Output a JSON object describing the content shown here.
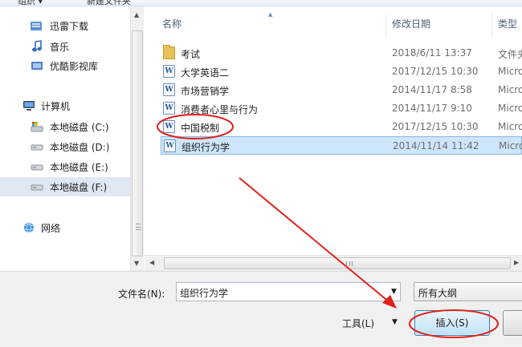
{
  "toolbar": {
    "organize": "组织 ▾",
    "new_folder": "新建文件夹"
  },
  "nav": {
    "items": [
      {
        "label": "迅雷下载",
        "icon": "thunder-download-folder-icon"
      },
      {
        "label": "音乐",
        "icon": "music-icon"
      },
      {
        "label": "优酷影视库",
        "icon": "video-library-icon"
      },
      {
        "label": "计算机",
        "icon": "computer-icon"
      },
      {
        "label": "本地磁盘 (C:)",
        "icon": "system-drive-icon"
      },
      {
        "label": "本地磁盘 (D:)",
        "icon": "drive-icon"
      },
      {
        "label": "本地磁盘 (E:)",
        "icon": "drive-icon"
      },
      {
        "label": "本地磁盘 (F:)",
        "icon": "drive-icon"
      },
      {
        "label": "网络",
        "icon": "network-icon"
      }
    ]
  },
  "list": {
    "columns": {
      "name": "名称",
      "date": "修改日期",
      "type": "类型"
    },
    "rows": [
      {
        "name": "考试",
        "date": "2018/6/11 13:37",
        "type": "文件夹",
        "icon": "folder-icon"
      },
      {
        "name": "大学英语二",
        "date": "2017/12/15 10:30",
        "type": "Micro",
        "icon": "word-document-icon"
      },
      {
        "name": "市场营销学",
        "date": "2014/11/17 8:58",
        "type": "Micro",
        "icon": "word-document-icon"
      },
      {
        "name": "消费者心里与行为",
        "date": "2014/11/17 9:10",
        "type": "Micro",
        "icon": "word-document-icon"
      },
      {
        "name": "中国税制",
        "date": "2017/12/15 10:30",
        "type": "Micro",
        "icon": "word-document-icon"
      },
      {
        "name": "组织行为学",
        "date": "2014/11/14 11:42",
        "type": "Micro",
        "icon": "word-document-icon"
      }
    ]
  },
  "bottom": {
    "filename_label": "文件名(N):",
    "filename_value": "组织行为学",
    "filter_value": "所有大纲",
    "tools_label": "工具(L)",
    "insert_label": "插入(S)"
  },
  "colors": {
    "selection": "#cde6fb",
    "annotation": "#e0201b",
    "accent": "#3c7fb1"
  }
}
